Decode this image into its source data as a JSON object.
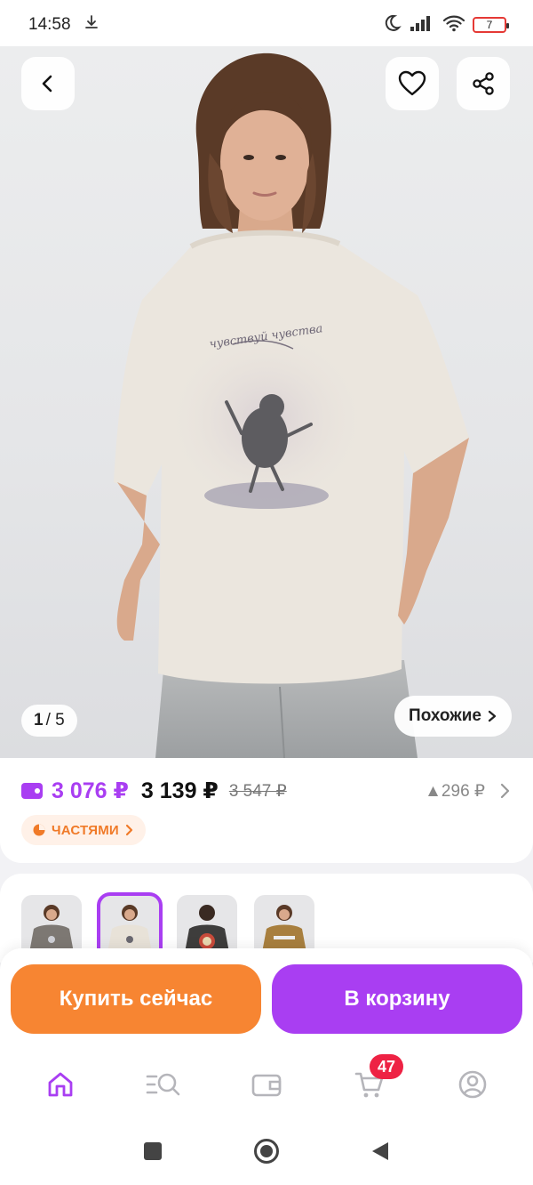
{
  "status_bar": {
    "time": "14:58",
    "battery_level": "7"
  },
  "hero": {
    "print_caption": "чувствуй чувства",
    "counter_current": "1",
    "counter_total": "/ 5",
    "similar_label": "Похожие"
  },
  "pricing": {
    "wallet_price": "3 076 ₽",
    "price": "3 139 ₽",
    "old_price": "3 547 ₽",
    "price_change": "▲296 ₽",
    "installments_label": "ЧАСТЯМИ"
  },
  "thumbnails": [
    {
      "color": "#7d7873",
      "selected": false
    },
    {
      "color": "#e8e2d8",
      "selected": true
    },
    {
      "color": "#3e3d3c",
      "selected": false
    },
    {
      "color": "#a87f3e",
      "selected": false
    }
  ],
  "actions": {
    "buy_now_label": "Купить сейчас",
    "add_to_cart_label": "В корзину"
  },
  "bottom_nav": {
    "items": [
      "home-icon",
      "catalog-search-icon",
      "wallet-icon",
      "cart-icon",
      "profile-icon"
    ],
    "active": "home-icon",
    "cart_badge": "47"
  },
  "colors": {
    "accent_purple": "#a93ef2",
    "accent_orange": "#f78532",
    "badge_red": "#ee2244"
  }
}
